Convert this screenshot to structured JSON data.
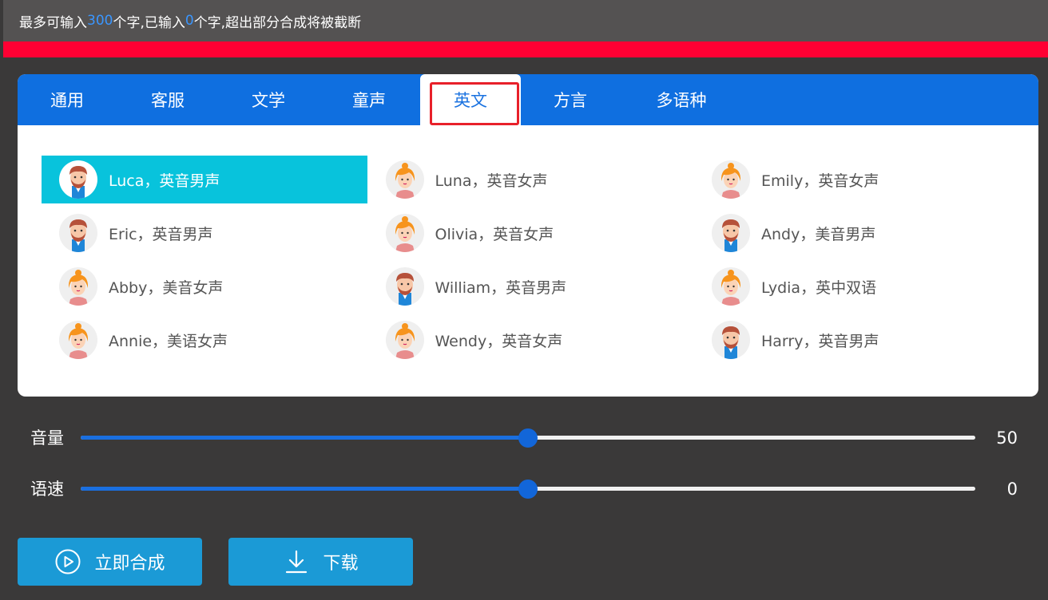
{
  "header": {
    "text_prefix": "最多可输入",
    "max_chars": "300",
    "text_middle": "个字,已输入",
    "entered_chars": "0",
    "text_suffix": "个字,超出部分合成将被截断"
  },
  "colors": {
    "accent": "#0f6fe0",
    "selected": "#08c3dc",
    "alert_bar": "#ff0033",
    "button": "#1b9ad6"
  },
  "tabs": [
    {
      "label": "通用"
    },
    {
      "label": "客服"
    },
    {
      "label": "文学"
    },
    {
      "label": "童声"
    },
    {
      "label": "英文",
      "active": true
    },
    {
      "label": "方言"
    },
    {
      "label": "多语种"
    }
  ],
  "voices": [
    {
      "label": "Luca，英音男声",
      "gender": "male",
      "selected": true
    },
    {
      "label": "Luna，英音女声",
      "gender": "female"
    },
    {
      "label": "Emily，英音女声",
      "gender": "female"
    },
    {
      "label": "Eric，英音男声",
      "gender": "male"
    },
    {
      "label": "Olivia，英音女声",
      "gender": "female"
    },
    {
      "label": "Andy，美音男声",
      "gender": "male"
    },
    {
      "label": "Abby，美音女声",
      "gender": "female"
    },
    {
      "label": "William，英音男声",
      "gender": "male"
    },
    {
      "label": "Lydia，英中双语",
      "gender": "female"
    },
    {
      "label": "Annie，美语女声",
      "gender": "female"
    },
    {
      "label": "Wendy，英音女声",
      "gender": "female"
    },
    {
      "label": "Harry，英音男声",
      "gender": "male"
    }
  ],
  "sliders": {
    "volume": {
      "label": "音量",
      "value": "50",
      "fraction": 0.5
    },
    "speed": {
      "label": "语速",
      "value": "0",
      "fraction": 0.5
    }
  },
  "buttons": {
    "synthesize": {
      "label": "立即合成",
      "icon": "play-circle-icon"
    },
    "download": {
      "label": "下载",
      "icon": "download-icon"
    }
  }
}
